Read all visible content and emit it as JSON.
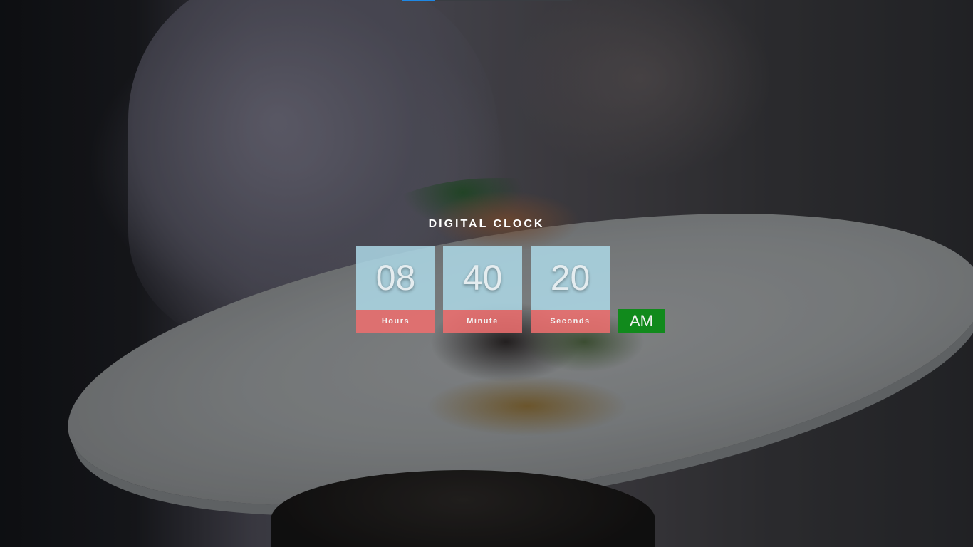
{
  "clock": {
    "title": "DIGITAL CLOCK",
    "hours": "08",
    "minutes": "40",
    "seconds": "20",
    "hours_label": "Hours",
    "minutes_label": "Minute",
    "seconds_label": "Seconds",
    "period": "AM"
  },
  "colors": {
    "digit_box": "#add8e6",
    "label_box": "#f06e6e",
    "period_badge": "#118a1c",
    "accent": "#1e88e5"
  }
}
